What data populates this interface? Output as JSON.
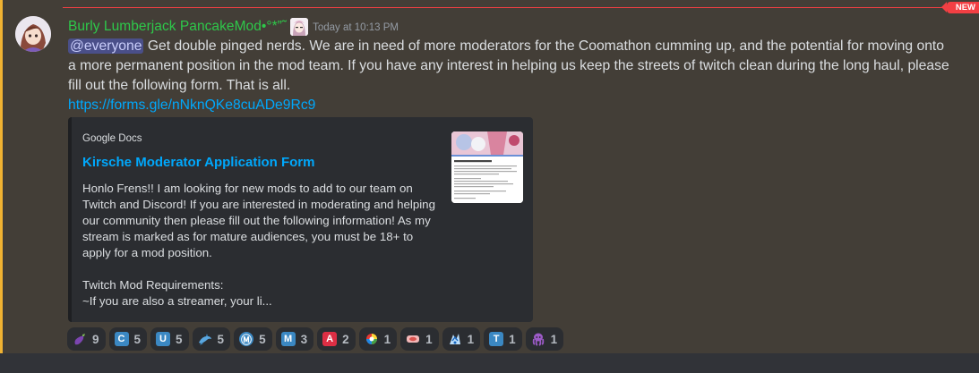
{
  "new_badge": "NEW",
  "message": {
    "username": "Burly Lumberjack PancakeMod•°*”˜",
    "timestamp": "Today at 10:13 PM",
    "mention": "@everyone",
    "text": " Get double pinged nerds. We are in need of more moderators for the Coomathon cumming up, and the potential for moving onto a more permanent position in the mod team. If you have any interest in helping us keep the streets of twitch clean during the long haul, please fill out the following form. That is all.",
    "link": "https://forms.gle/nNknQKe8cuADe9Rc9"
  },
  "embed": {
    "provider": "Google Docs",
    "title": "Kirsche Moderator Application Form",
    "description": "Honlo Frens!! I am looking for new mods to add to our team on Twitch and Discord! If you are interested in moderating and helping our community then please fill out the following information! As my stream is marked as for mature audiences, you must be 18+ to apply for a mod position.\n\nTwitch Mod Requirements:\n~If you are also a streamer, your li..."
  },
  "reactions": [
    {
      "icon": "eggplant-emoji",
      "label": "",
      "color": "#6b3fa0",
      "count": "9"
    },
    {
      "icon": "c-emoji",
      "label": "C",
      "color": "#3b88c3",
      "count": "5"
    },
    {
      "icon": "u-emoji",
      "label": "U",
      "color": "#3b88c3",
      "count": "5"
    },
    {
      "icon": "dolphin-emoji",
      "label": "",
      "color": "#5aa7e0",
      "count": "5"
    },
    {
      "icon": "circled-m-emoji",
      "label": "Ⓜ",
      "color": "#3b88c3",
      "count": "5"
    },
    {
      "icon": "m-emoji",
      "label": "M",
      "color": "#3b88c3",
      "count": "3"
    },
    {
      "icon": "a-button-emoji",
      "label": "A",
      "color": "#dd2e44",
      "count": "2"
    },
    {
      "icon": "custom-emoji-1",
      "label": "",
      "color": "#8bc34a",
      "count": "1"
    },
    {
      "icon": "custom-emoji-2",
      "label": "",
      "color": "#e57373",
      "count": "1"
    },
    {
      "icon": "custom-emoji-3",
      "label": "",
      "color": "#90caf9",
      "count": "1"
    },
    {
      "icon": "t-emoji",
      "label": "T",
      "color": "#3b88c3",
      "count": "1"
    },
    {
      "icon": "octopus-emoji",
      "label": "",
      "color": "#9c27b0",
      "count": "1"
    }
  ]
}
